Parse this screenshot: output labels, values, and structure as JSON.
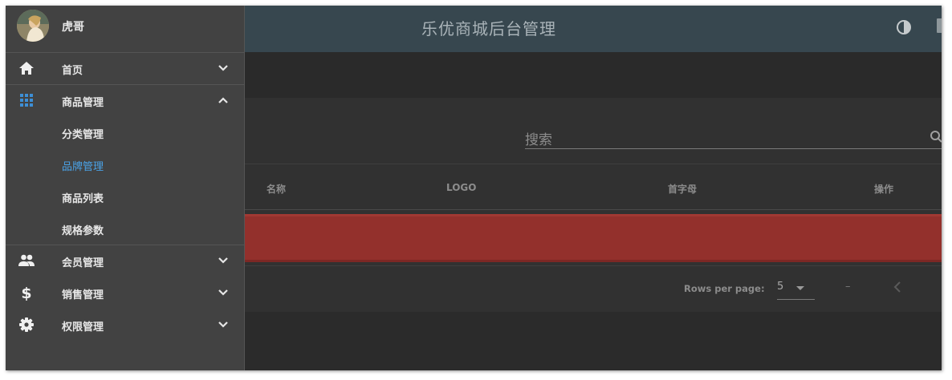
{
  "app": {
    "title": "乐优商城后台管理"
  },
  "user": {
    "name": "虎哥"
  },
  "nav": {
    "items": [
      {
        "label": "首页",
        "icon": "home-icon"
      },
      {
        "label": "商品管理",
        "icon": "apps-grid-icon",
        "expanded": true
      },
      {
        "label": "会员管理",
        "icon": "people-icon"
      },
      {
        "label": "销售管理",
        "icon": "dollar-icon"
      },
      {
        "label": "权限管理",
        "icon": "gear-icon"
      }
    ],
    "sub_items": [
      {
        "label": "分类管理"
      },
      {
        "label": "品牌管理",
        "active": true
      },
      {
        "label": "商品列表"
      },
      {
        "label": "规格参数"
      }
    ]
  },
  "search": {
    "label": "搜索"
  },
  "table": {
    "headers": [
      "名称",
      "LOGO",
      "首字母",
      "操作"
    ]
  },
  "pagination": {
    "rows_per_page_label": "Rows per page:",
    "rows_per_page_value": "5",
    "range": "–"
  },
  "colors": {
    "toolbar": "#37474f",
    "drawer": "#424242",
    "accent": "#4aa3e8",
    "error_row": "#93302c"
  }
}
